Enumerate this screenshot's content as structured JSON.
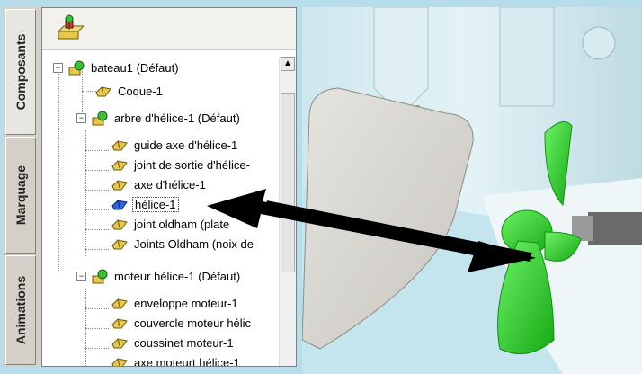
{
  "tabs": [
    {
      "label": "Composants"
    },
    {
      "label": "Marquage"
    },
    {
      "label": "Animations"
    }
  ],
  "tree": [
    {
      "label": "bateau1 (Défaut)",
      "icon": "assembly-icon"
    },
    {
      "label": "Coque-1",
      "icon": "part-icon"
    },
    {
      "label": "arbre d'hélice-1 (Défaut)",
      "icon": "assembly-icon"
    },
    {
      "label": "guide axe d'hélice-1",
      "icon": "part-icon"
    },
    {
      "label": "joint de sortie d'hélice-",
      "icon": "part-icon"
    },
    {
      "label": "axe d'hélice-1",
      "icon": "part-icon"
    },
    {
      "label": "hélice-1",
      "icon": "part-selected-icon"
    },
    {
      "label": "joint oldham (plate",
      "icon": "part-icon"
    },
    {
      "label": "Joints Oldham (noix de",
      "icon": "part-icon"
    },
    {
      "label": "moteur hélice-1 (Défaut)",
      "icon": "assembly-icon"
    },
    {
      "label": "enveloppe moteur-1",
      "icon": "part-icon"
    },
    {
      "label": "couvercle moteur hélic",
      "icon": "part-icon"
    },
    {
      "label": "coussinet moteur-1",
      "icon": "part-icon"
    },
    {
      "label": "axe moteurt hélice-1",
      "icon": "part-icon"
    }
  ],
  "colors": {
    "propeller": "#2fd12a",
    "selected_part": "#2a66d9",
    "part": "#e7c84a"
  }
}
